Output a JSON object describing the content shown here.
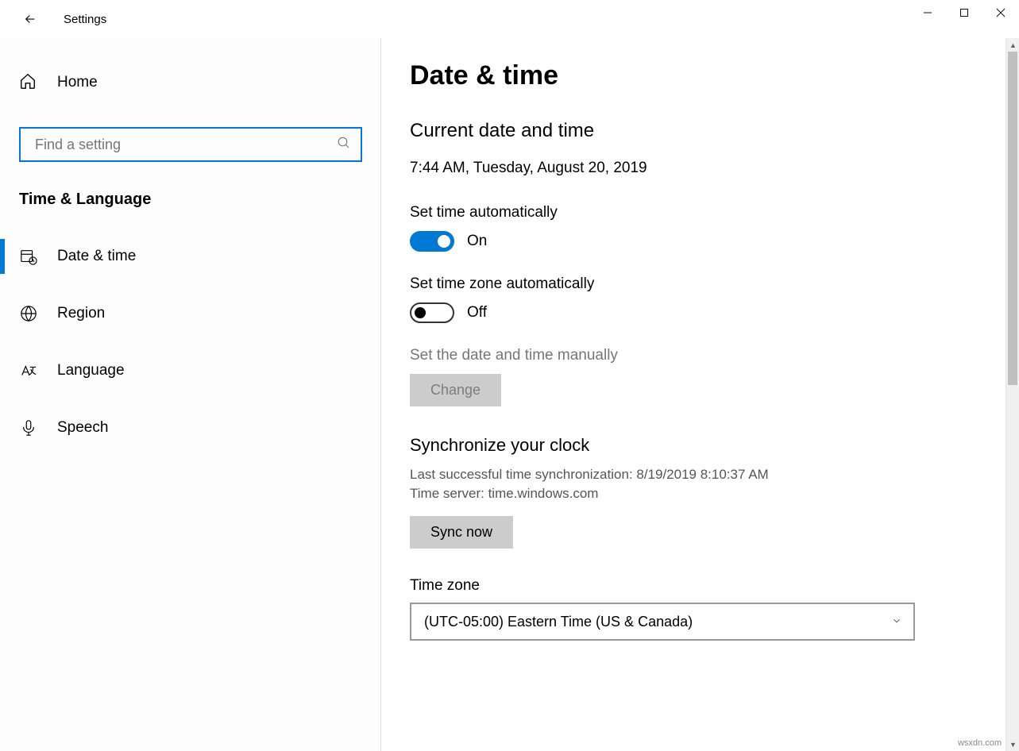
{
  "window": {
    "title": "Settings"
  },
  "sidebar": {
    "home_label": "Home",
    "search_placeholder": "Find a setting",
    "category_label": "Time & Language",
    "items": [
      {
        "label": "Date & time",
        "icon": "calendar-clock-icon",
        "active": true
      },
      {
        "label": "Region",
        "icon": "globe-icon",
        "active": false
      },
      {
        "label": "Language",
        "icon": "language-icon",
        "active": false
      },
      {
        "label": "Speech",
        "icon": "microphone-icon",
        "active": false
      }
    ]
  },
  "main": {
    "page_title": "Date & time",
    "current_heading": "Current date and time",
    "current_value": "7:44 AM, Tuesday, August 20, 2019",
    "set_time_auto": {
      "label": "Set time automatically",
      "on": true,
      "state_text": "On"
    },
    "set_tz_auto": {
      "label": "Set time zone automatically",
      "on": false,
      "state_text": "Off"
    },
    "manual": {
      "label": "Set the date and time manually",
      "button": "Change"
    },
    "sync": {
      "heading": "Synchronize your clock",
      "last_success_label": "Last successful time synchronization:",
      "last_success_value": "8/19/2019 8:10:37 AM",
      "server_label": "Time server:",
      "server_value": "time.windows.com",
      "button": "Sync now"
    },
    "timezone": {
      "label": "Time zone",
      "value": "(UTC-05:00) Eastern Time (US & Canada)"
    }
  },
  "watermark": "wsxdn.com"
}
